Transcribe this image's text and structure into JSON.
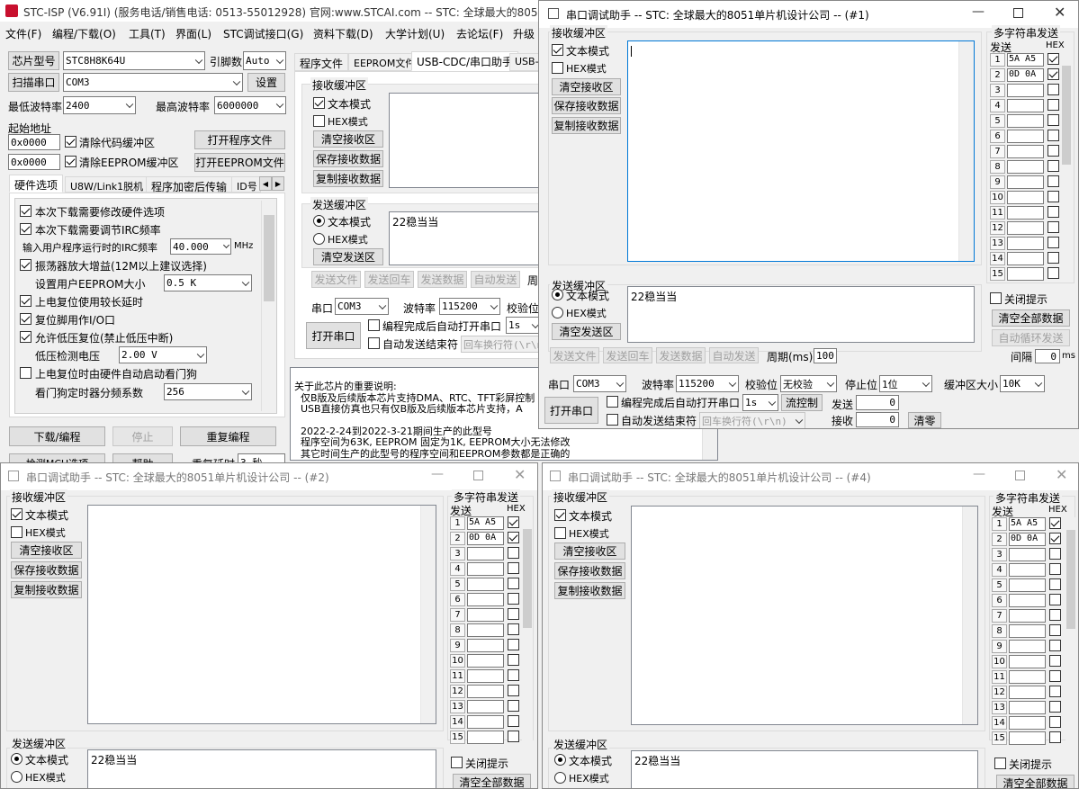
{
  "main": {
    "title": "STC-ISP (V6.91I) (服务电话/销售电话: 0513-55012928) 官网:www.STCAI.com  -- STC: 全球最大的8051单",
    "menu": [
      "文件(F)",
      "编程/下载(O)",
      "工具(T)",
      "界面(L)",
      "STC调试接口(G)",
      "资料下载(D)",
      "大学计划(U)",
      "去论坛(F)",
      "升级"
    ],
    "chip_label": "芯片型号",
    "chip_value": "STC8H8K64U",
    "pins_label": "引脚数",
    "pins_value": "Auto",
    "scan_port": "扫描串口",
    "port_value": "COM3",
    "settings": "设置",
    "min_baud_label": "最低波特率",
    "min_baud": "2400",
    "max_baud_label": "最高波特率",
    "max_baud": "6000000",
    "start_addr_label": "起始地址",
    "addr1": "0x0000",
    "clear_code": "清除代码缓冲区",
    "open_prog": "打开程序文件",
    "addr2": "0x0000",
    "clear_eeprom": "清除EEPROM缓冲区",
    "open_eeprom": "打开EEPROM文件",
    "hw_tabs": [
      "硬件选项",
      "U8W/Link1脱机",
      "程序加密后传输",
      "ID号"
    ],
    "options": [
      {
        "label": "本次下载需要修改硬件选项",
        "checked": true
      },
      {
        "label": "本次下载需要调节IRC频率",
        "checked": true
      },
      {
        "label": "输入用户程序运行时的IRC频率",
        "checked": null
      },
      {
        "label": "振荡器放大增益(12M以上建议选择)",
        "checked": true
      },
      {
        "label": "设置用户EEPROM大小",
        "checked": null
      },
      {
        "label": "上电复位使用较长延时",
        "checked": true
      },
      {
        "label": "复位脚用作I/O口",
        "checked": true
      },
      {
        "label": "允许低压复位(禁止低压中断)",
        "checked": true
      },
      {
        "label": "低压检测电压",
        "checked": null
      },
      {
        "label": "上电复位时由硬件自动启动看门狗",
        "checked": false
      },
      {
        "label": "看门狗定时器分频系数",
        "checked": null
      }
    ],
    "irc_freq": "40.000",
    "mhz": "MHz",
    "eeprom_size": "0.5 K",
    "lvd": "2.00 V",
    "wdt_div": "256",
    "download": "下载/编程",
    "stop": "停止",
    "reprogram": "重复编程",
    "bottom_partial": [
      "检测MCU选项",
      "帮助",
      "重复延时",
      "3 秒"
    ],
    "right_tabs": [
      "程序文件",
      "EEPROM文件",
      "USB-CDC/串口助手",
      "USB-"
    ],
    "recv_group": "接收缓冲区",
    "text_mode": "文本模式",
    "hex_mode": "HEX模式",
    "clear_recv": "清空接收区",
    "save_recv": "保存接收数据",
    "copy_recv": "复制接收数据",
    "send_group": "发送缓冲区",
    "send_text": "22稳当当",
    "clear_send": "清空发送区",
    "send_file": "发送文件",
    "send_return": "发送回车",
    "send_data": "发送数据",
    "auto_send": "自动发送",
    "period_short": "周",
    "port_label": "串口",
    "baud_label": "波特率",
    "baud": "115200",
    "parity_short": "校验位",
    "auto_open": "编程完成后自动打开串口",
    "auto_open_val": "1s",
    "auto_end": "自动发送结束符",
    "end_char": "回车换行符(\\r\\n)",
    "open_port": "打开串口",
    "info_lines": [
      "关于此芯片的重要说明:",
      "  仅B版及后续版本芯片支持DMA、RTC、TFT彩屏控制",
      "  USB直接仿真也只有仅B版及后续版本芯片支持，A",
      "",
      "  2022-2-24到2022-3-21期间生产的此型号",
      "  程序空间为63K, EEPROM 固定为1K, EEPROM大小无法修改",
      "  其它时间生产的此型号的程序空间和EEPROM参数都是正确的"
    ]
  },
  "win1": {
    "title": "串口调试助手 -- STC: 全球最大的8051单片机设计公司 -- (#1)",
    "recv_group": "接收缓冲区",
    "multi_title": "多字符串发送",
    "send_hdr": "发送",
    "hex_hdr": "HEX",
    "rows": [
      {
        "n": "1",
        "v": "5A A5 .",
        "hex": true
      },
      {
        "n": "2",
        "v": "0D 0A",
        "hex": true
      },
      {
        "n": "3",
        "v": "",
        "hex": false
      },
      {
        "n": "4",
        "v": "",
        "hex": false
      },
      {
        "n": "5",
        "v": "",
        "hex": false
      },
      {
        "n": "6",
        "v": "",
        "hex": false
      },
      {
        "n": "7",
        "v": "",
        "hex": false
      },
      {
        "n": "8",
        "v": "",
        "hex": false
      },
      {
        "n": "9",
        "v": "",
        "hex": false
      },
      {
        "n": "10",
        "v": "",
        "hex": false
      },
      {
        "n": "11",
        "v": "",
        "hex": false
      },
      {
        "n": "12",
        "v": "",
        "hex": false
      },
      {
        "n": "13",
        "v": "",
        "hex": false
      },
      {
        "n": "14",
        "v": "",
        "hex": false
      },
      {
        "n": "15",
        "v": "",
        "hex": false
      }
    ],
    "close_prompt": "关闭提示",
    "clear_all": "清空全部数据",
    "auto_loop": "自动循环发送",
    "interval": "间隔",
    "interval_val": "0",
    "ms": "ms",
    "period": "周期(ms)",
    "period_val": "100",
    "parity": "无校验",
    "stop_label": "停止位",
    "stop_val": "1位",
    "buf_label": "缓冲区大小",
    "buf_val": "10K",
    "flow": "流控制",
    "send_cnt_label": "发送",
    "send_cnt": "0",
    "recv_cnt_label": "接收",
    "recv_cnt": "0",
    "clear_zero": "清零",
    "parity_label": "校验位"
  },
  "win2": {
    "title": "串口调试助手 -- STC: 全球最大的8051单片机设计公司 -- (#2)"
  },
  "win4": {
    "title": "串口调试助手 -- STC: 全球最大的8051单片机设计公司 -- (#4)"
  }
}
